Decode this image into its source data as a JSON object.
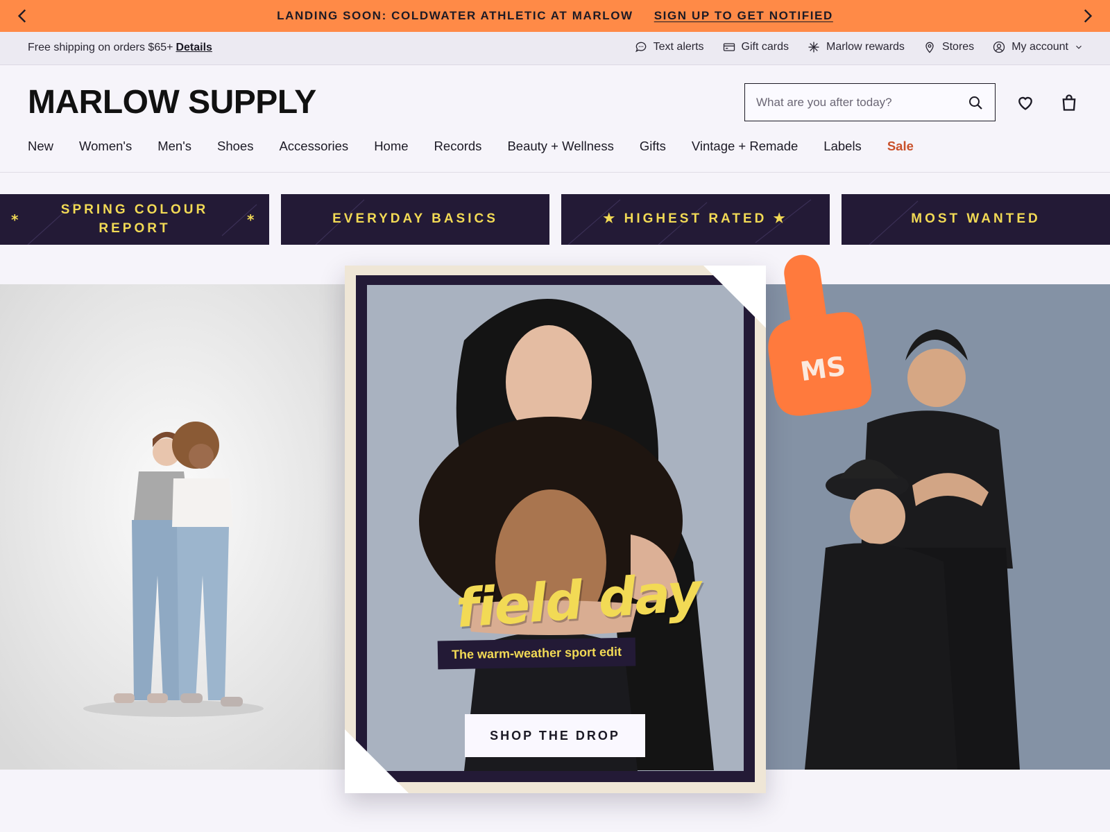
{
  "promo": {
    "message": "LANDING SOON: COLDWATER ATHLETIC AT MARLOW",
    "cta": "SIGN UP TO GET NOTIFIED"
  },
  "utility": {
    "shipping_text": "Free shipping on orders $65+",
    "shipping_link": "Details",
    "links": [
      "Text alerts",
      "Gift cards",
      "Marlow rewards",
      "Stores",
      "My account"
    ]
  },
  "header": {
    "logo": "MARLOW SUPPLY",
    "search_placeholder": "What are you after today?"
  },
  "nav": {
    "items": [
      "New",
      "Women's",
      "Men's",
      "Shoes",
      "Accessories",
      "Home",
      "Records",
      "Beauty + Wellness",
      "Gifts",
      "Vintage + Remade",
      "Labels",
      "Sale"
    ]
  },
  "collections": [
    {
      "label": "SPRING COLOUR REPORT"
    },
    {
      "label": "EVERYDAY BASICS"
    },
    {
      "label": "HIGHEST RATED"
    },
    {
      "label": "MOST WANTED"
    }
  ],
  "hero": {
    "headline": "field day",
    "subheadline": "The warm-weather sport edit",
    "cta": "SHOP THE DROP",
    "badge": "MS"
  },
  "colors": {
    "promo_bg": "#ff8a47",
    "navy": "#231a36",
    "yellow": "#f2da55",
    "sale_red": "#c9502a",
    "badge_orange": "#ff7a3d"
  }
}
